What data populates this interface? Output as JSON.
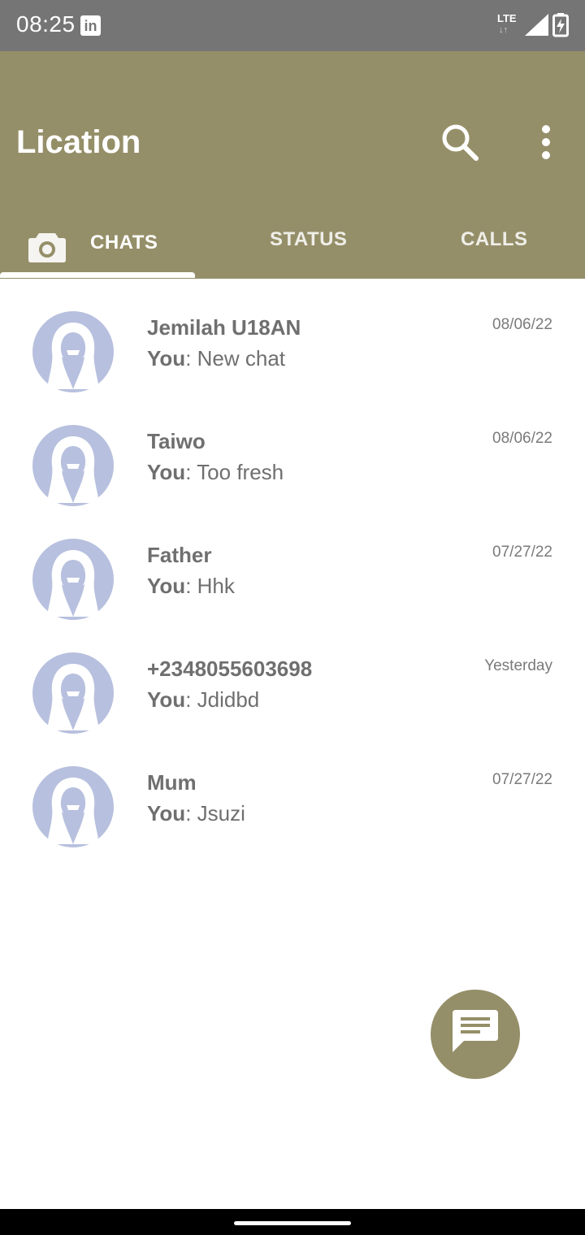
{
  "status_bar": {
    "time": "08:25",
    "app_badge": "in",
    "network": "LTE",
    "network_arrows": "↓↑"
  },
  "app_bar": {
    "title": "Lication",
    "color": "#958f69",
    "actions": [
      "search-icon",
      "more-vert-icon"
    ]
  },
  "tabs": [
    {
      "label": "CHATS",
      "active": true
    },
    {
      "label": "STATUS",
      "active": false
    },
    {
      "label": "CALLS",
      "active": false
    }
  ],
  "chats": [
    {
      "name": "Jemilah U18AN",
      "sender": "You",
      "separator": ":",
      "message": " New chat",
      "date": "08/06/22"
    },
    {
      "name": "Taiwo",
      "sender": "You",
      "separator": ":",
      "message": " Too fresh",
      "date": "08/06/22"
    },
    {
      "name": "Father",
      "sender": "You",
      "separator": ":",
      "message": " Hhk",
      "date": "07/27/22"
    },
    {
      "name": "+2348055603698",
      "sender": "You",
      "separator": ":",
      "message": " Jdidbd",
      "date": "Yesterday"
    },
    {
      "name": "Mum",
      "sender": "You",
      "separator": ":",
      "message": " Jsuzi",
      "date": "07/27/22"
    }
  ],
  "fab": {
    "icon": "message-icon"
  },
  "colors": {
    "accent": "#958f69",
    "avatar": "#b7c0de",
    "status_bar": "#757575"
  }
}
